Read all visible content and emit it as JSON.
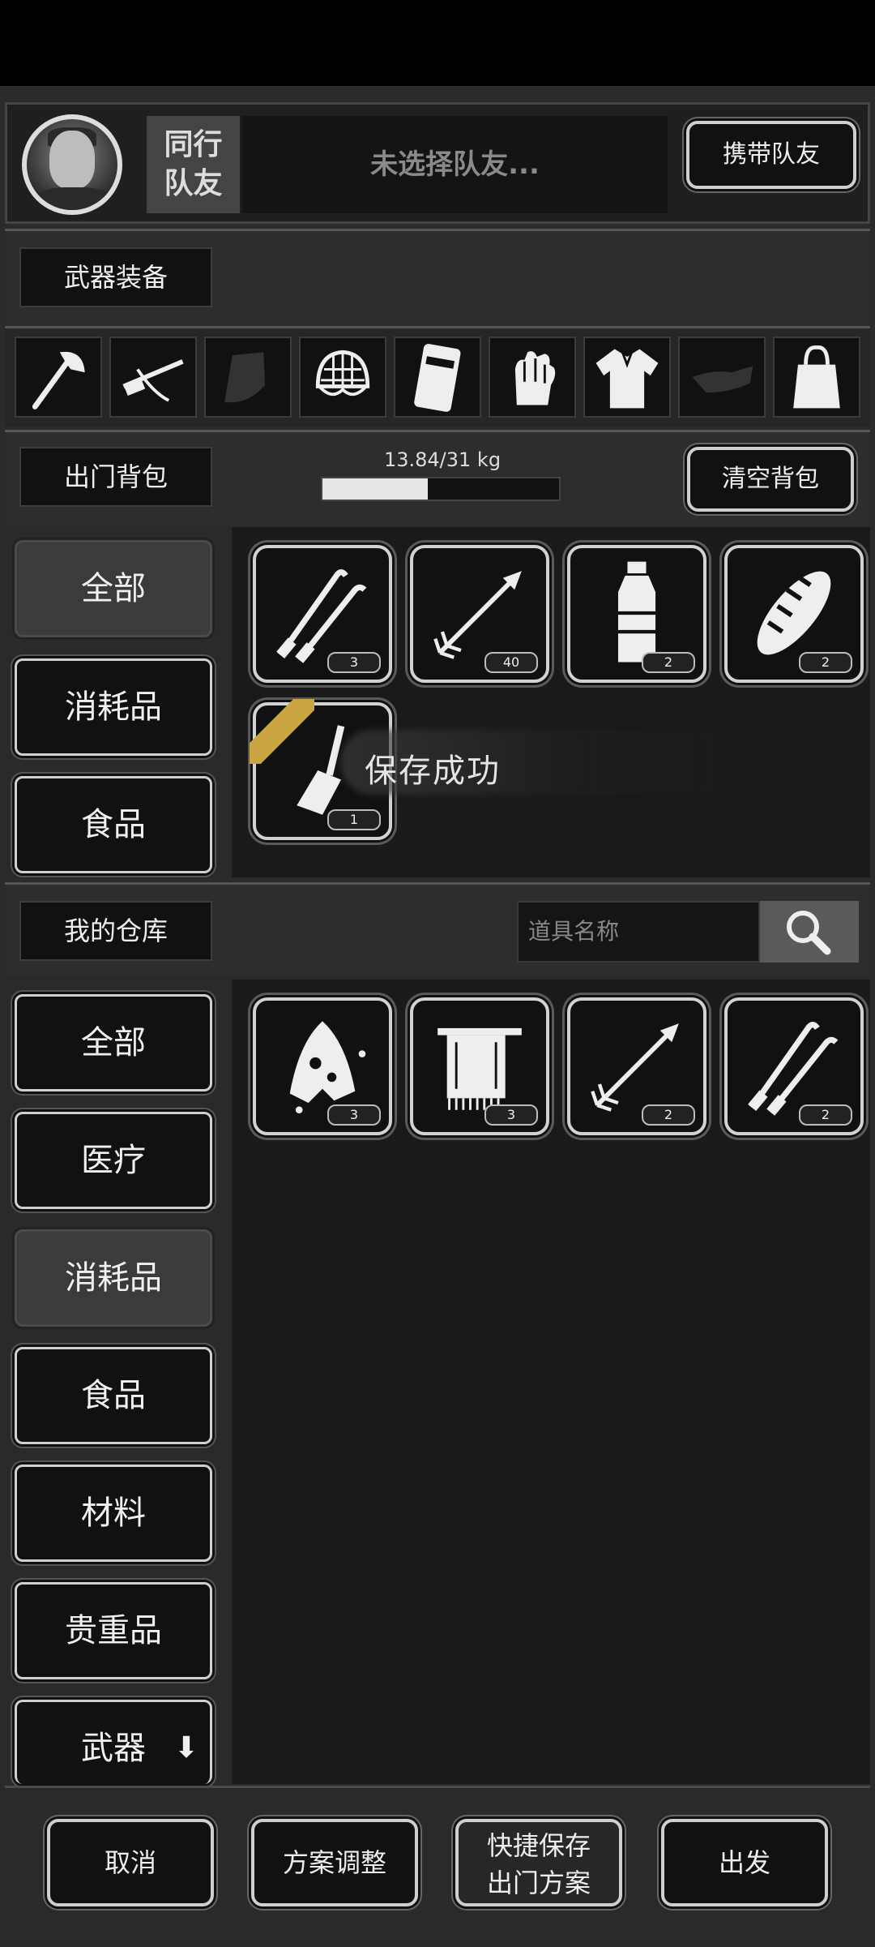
{
  "companion": {
    "label": "同行\n队友",
    "label_line1": "同行",
    "label_line2": "队友",
    "slot_text": "未选择队友...",
    "bring_button": "携带队友"
  },
  "weapons": {
    "title": "武器装备",
    "slots": [
      {
        "icon": "axe-icon",
        "filled": true
      },
      {
        "icon": "crossbow-icon",
        "filled": true
      },
      {
        "icon": "armor-icon",
        "filled": false
      },
      {
        "icon": "helmet-icon",
        "filled": true
      },
      {
        "icon": "shield-icon",
        "filled": true
      },
      {
        "icon": "glove-icon",
        "filled": true
      },
      {
        "icon": "shirt-icon",
        "filled": true
      },
      {
        "icon": "shoe-icon",
        "filled": false
      },
      {
        "icon": "bag-icon",
        "filled": true
      }
    ]
  },
  "backpack": {
    "title": "出门背包",
    "weight_text": "13.84/31 kg",
    "weight_fraction": 0.446,
    "clear_button": "清空背包",
    "categories": [
      "全部",
      "消耗品",
      "食品"
    ],
    "active_category": 0,
    "items": [
      {
        "icon": "lockpick-icon",
        "count": "3"
      },
      {
        "icon": "arrow-icon",
        "count": "40"
      },
      {
        "icon": "water-bottle-icon",
        "count": "2"
      },
      {
        "icon": "bread-icon",
        "count": "2"
      },
      {
        "icon": "shovel-icon",
        "count": "1",
        "starred": true
      }
    ],
    "toast": "保存成功"
  },
  "warehouse": {
    "title": "我的仓库",
    "search_placeholder": "道具名称",
    "categories": [
      "全部",
      "医疗",
      "消耗品",
      "食品",
      "材料",
      "贵重品",
      "武器"
    ],
    "active_category": 2,
    "items": [
      {
        "icon": "cloth-icon",
        "count": "3"
      },
      {
        "icon": "towel-icon",
        "count": "3"
      },
      {
        "icon": "arrow-icon",
        "count": "2"
      },
      {
        "icon": "lockpick-icon",
        "count": "2"
      }
    ]
  },
  "bottom": {
    "cancel": "取消",
    "adjust": "方案调整",
    "quick_save_line1": "快捷保存",
    "quick_save_line2": "出门方案",
    "depart": "出发"
  },
  "colors": {
    "background": "#2b2b2b",
    "panel": "#1a1a1a",
    "accent_gold": "#c9a642",
    "text": "#eeeeee"
  }
}
